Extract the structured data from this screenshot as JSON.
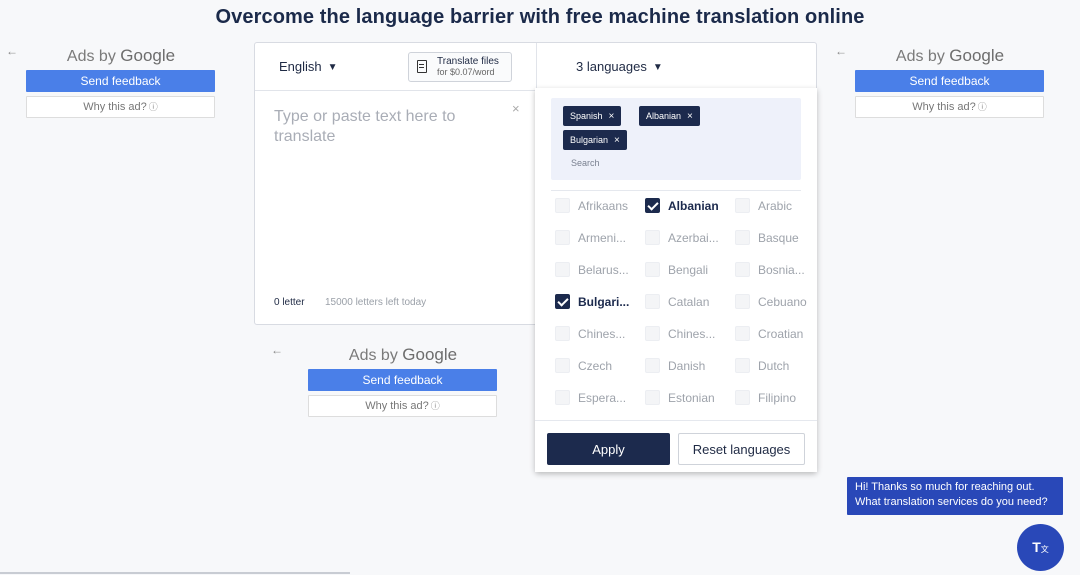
{
  "headline": "Overcome the language barrier with free machine translation online",
  "ads": {
    "back_arrow": "←",
    "adsby_prefix": "Ads by ",
    "adsby_brand": "Google",
    "feedback": "Send feedback",
    "why": "Why this ad?",
    "info_glyph": "ⓘ"
  },
  "translator": {
    "source_language": "English",
    "translate_files_title": "Translate files",
    "translate_files_price": "for $0.07/word",
    "source_placeholder": "Type or paste text here to translate",
    "clear_glyph": "×",
    "letter_count": "0 letter",
    "letters_left": "15000 letters left today",
    "target_languages": "3 languages"
  },
  "dropdown": {
    "chips": [
      {
        "label": "Spanish"
      },
      {
        "label": "Albanian"
      },
      {
        "label": "Bulgarian"
      }
    ],
    "search_placeholder": "Search",
    "options": [
      {
        "label": "Afrikaans",
        "checked": false
      },
      {
        "label": "Albanian",
        "checked": true
      },
      {
        "label": "Arabic",
        "checked": false
      },
      {
        "label": "Armeni...",
        "checked": false
      },
      {
        "label": "Azerbai...",
        "checked": false
      },
      {
        "label": "Basque",
        "checked": false
      },
      {
        "label": "Belarus...",
        "checked": false
      },
      {
        "label": "Bengali",
        "checked": false
      },
      {
        "label": "Bosnia...",
        "checked": false
      },
      {
        "label": "Bulgari...",
        "checked": true
      },
      {
        "label": "Catalan",
        "checked": false
      },
      {
        "label": "Cebuano",
        "checked": false
      },
      {
        "label": "Chines...",
        "checked": false
      },
      {
        "label": "Chines...",
        "checked": false
      },
      {
        "label": "Croatian",
        "checked": false
      },
      {
        "label": "Czech",
        "checked": false
      },
      {
        "label": "Danish",
        "checked": false
      },
      {
        "label": "Dutch",
        "checked": false
      },
      {
        "label": "Espera...",
        "checked": false
      },
      {
        "label": "Estonian",
        "checked": false
      },
      {
        "label": "Filipino",
        "checked": false
      }
    ],
    "apply_label": "Apply",
    "reset_label": "Reset languages"
  },
  "chat": {
    "message": "Hi! Thanks so much for reaching out. What translation services do you need?",
    "button_glyph": "T",
    "button_sub": "文"
  },
  "colors": {
    "accent_navy": "#1c2a4d",
    "ad_blue": "#4a7fe8",
    "chat_blue": "#2948b8"
  }
}
